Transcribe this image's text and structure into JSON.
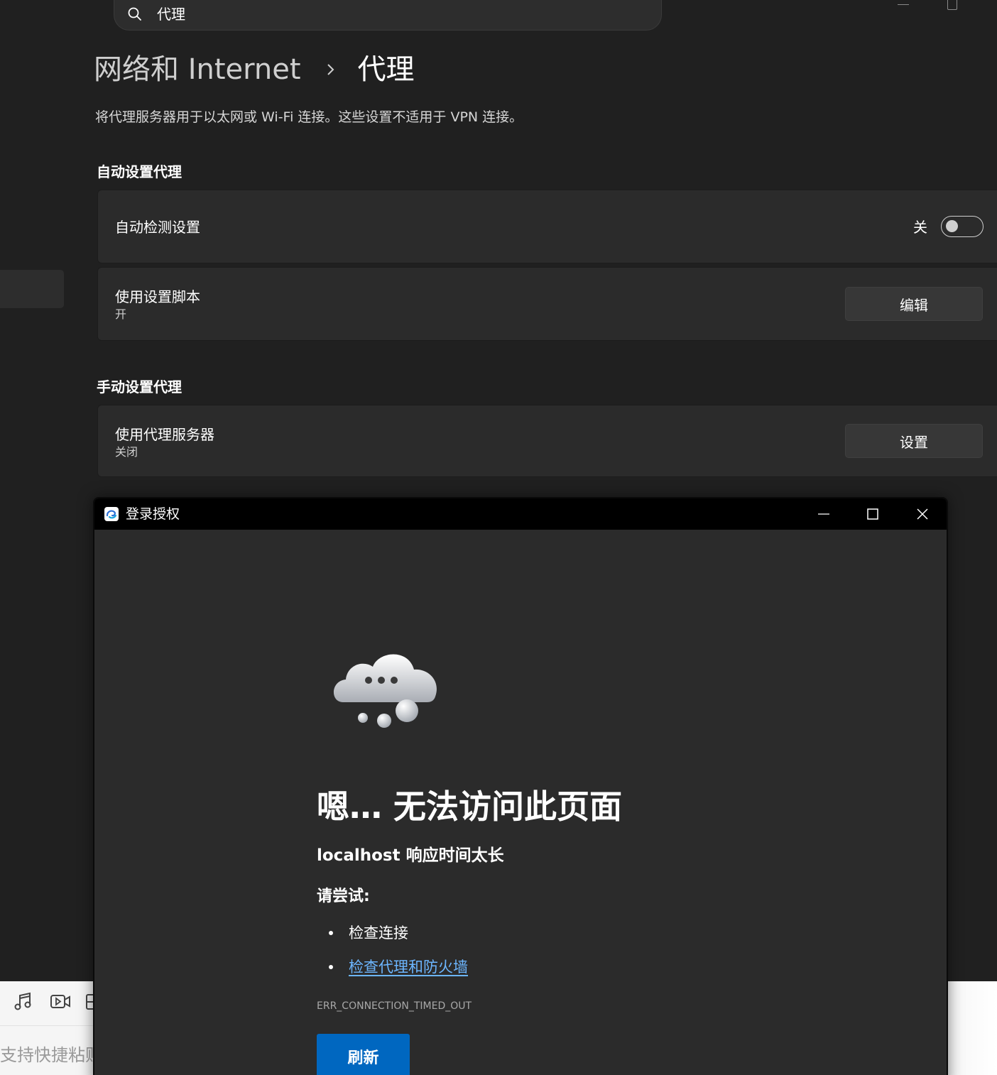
{
  "settings": {
    "search": {
      "value": "代理"
    },
    "breadcrumb": {
      "parent": "网络和 Internet",
      "current": "代理"
    },
    "description": "将代理服务器用于以太网或 Wi-Fi 连接。这些设置不适用于 VPN 连接。",
    "auto_section": {
      "title": "自动设置代理",
      "detect": {
        "label": "自动检测设置",
        "state_label": "关",
        "on": false
      },
      "script": {
        "label": "使用设置脚本",
        "status": "开",
        "button": "编辑"
      }
    },
    "manual_section": {
      "title": "手动设置代理",
      "proxy": {
        "label": "使用代理服务器",
        "status": "关闭",
        "button": "设置"
      }
    }
  },
  "background_app": {
    "paste_hint": "支持快捷粘贴",
    "icons": [
      "music-note-icon",
      "video-icon",
      "file-icon"
    ]
  },
  "dialog": {
    "title": "登录授权",
    "error": {
      "heading": "嗯… 无法访问此页面",
      "subheading": "localhost 响应时间太长",
      "try_label": "请尝试:",
      "tips": [
        {
          "text": "检查连接",
          "is_link": false
        },
        {
          "text": "检查代理和防火墙",
          "is_link": true
        }
      ],
      "code": "ERR_CONNECTION_TIMED_OUT",
      "refresh_button": "刷新"
    }
  },
  "colors": {
    "settings_bg": "#202020",
    "card_bg": "#2b2b2b",
    "link": "#6cb6ff",
    "primary_button": "#0067c0",
    "dialog_titlebar": "#000000"
  }
}
